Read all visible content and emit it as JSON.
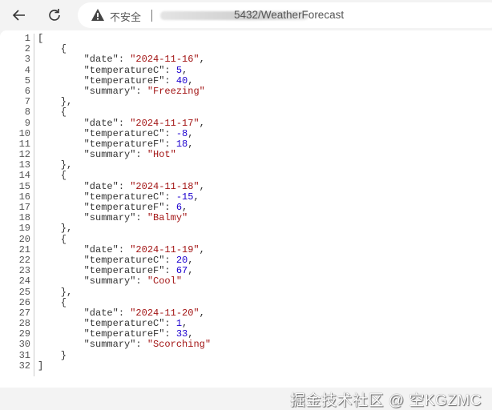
{
  "browser": {
    "security_label": "不安全",
    "url_visible": "5432/WeatherForecast"
  },
  "forecast": [
    {
      "date": "2024-11-16",
      "temperatureC": 5,
      "temperatureF": 40,
      "summary": "Freezing"
    },
    {
      "date": "2024-11-17",
      "temperatureC": -8,
      "temperatureF": 18,
      "summary": "Hot"
    },
    {
      "date": "2024-11-18",
      "temperatureC": -15,
      "temperatureF": 6,
      "summary": "Balmy"
    },
    {
      "date": "2024-11-19",
      "temperatureC": 20,
      "temperatureF": 67,
      "summary": "Cool"
    },
    {
      "date": "2024-11-20",
      "temperatureC": 1,
      "temperatureF": 33,
      "summary": "Scorching"
    }
  ],
  "watermark": "掘金技术社区 @ 空KGZMC"
}
